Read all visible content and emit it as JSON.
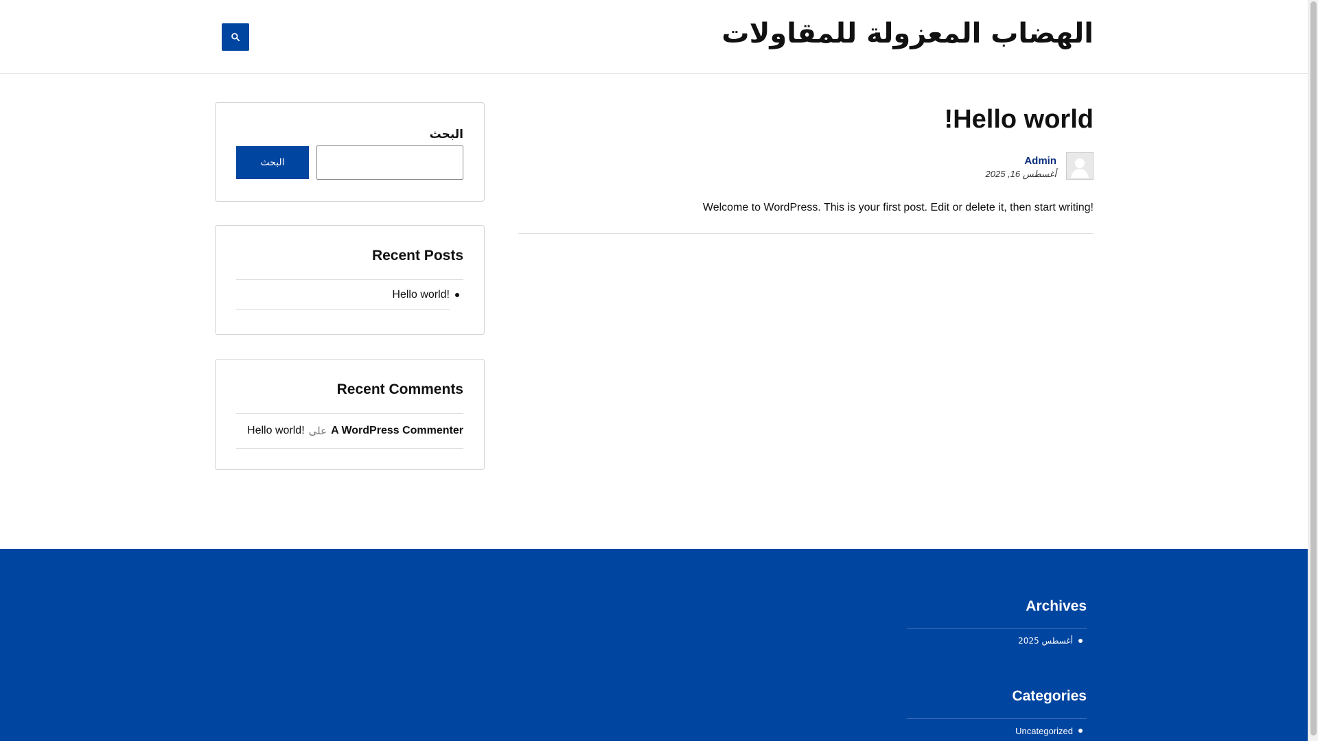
{
  "header": {
    "site_title": "الهضاب المعزولة للمقاولات",
    "search_toggle_icon": "search-icon"
  },
  "post": {
    "title": "Hello world!",
    "author": "Admin",
    "date": "أغسطس 16, 2025",
    "excerpt": "Welcome to WordPress. This is your first post. Edit or delete it, then start writing!",
    "avatar_icon": "user-avatar-icon"
  },
  "sidebar": {
    "search": {
      "title": "البحث",
      "placeholder": "",
      "button_label": "البحث"
    },
    "recent_posts": {
      "title": "Recent Posts",
      "items": [
        {
          "label": "Hello world!"
        }
      ]
    },
    "recent_comments": {
      "title": "Recent Comments",
      "items": [
        {
          "author": "A WordPress Commenter",
          "on": "على",
          "post": "Hello world!"
        }
      ]
    }
  },
  "footer": {
    "archives": {
      "title": "Archives",
      "items": [
        {
          "label": "أغسطس 2025"
        }
      ]
    },
    "categories": {
      "title": "Categories",
      "items": [
        {
          "label": "Uncategorized"
        }
      ]
    }
  },
  "colors": {
    "accent": "#0045a0",
    "author_link": "#0b2f7d",
    "text": "#111111"
  }
}
